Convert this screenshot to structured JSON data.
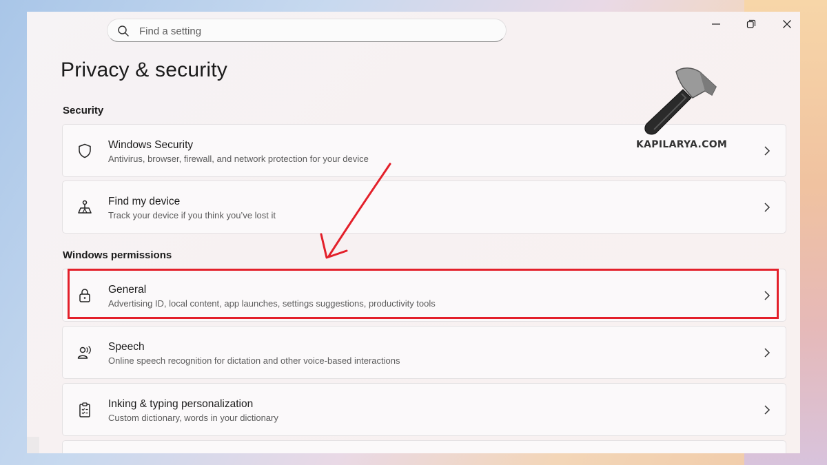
{
  "search": {
    "placeholder": "Find a setting"
  },
  "window_controls": [
    "minimize-icon",
    "restore-icon",
    "close-icon"
  ],
  "page": {
    "title": "Privacy & security"
  },
  "sections": {
    "security": {
      "label": "Security",
      "items": [
        {
          "title": "Windows Security",
          "description": "Antivirus, browser, firewall, and network protection for your device",
          "icon": "shield-icon"
        },
        {
          "title": "Find my device",
          "description": "Track your device if you think you’ve lost it",
          "icon": "find-device-icon"
        }
      ]
    },
    "permissions": {
      "label": "Windows permissions",
      "items": [
        {
          "title": "General",
          "description": "Advertising ID, local content, app launches, settings suggestions, productivity tools",
          "icon": "lock-icon"
        },
        {
          "title": "Speech",
          "description": "Online speech recognition for dictation and other voice-based interactions",
          "icon": "speech-icon"
        },
        {
          "title": "Inking & typing personalization",
          "description": "Custom dictionary, words in your dictionary",
          "icon": "clipboard-icon"
        }
      ]
    }
  },
  "watermark": {
    "text": "KAPILARYA.COM",
    "icon": "hammer-icon"
  },
  "annotation": {
    "highlight_color": "#e3202a",
    "arrow_color": "#e3202a"
  }
}
